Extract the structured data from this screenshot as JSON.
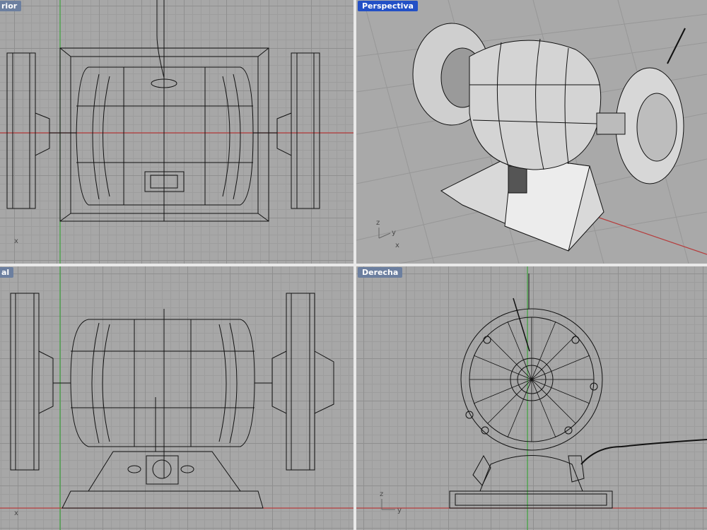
{
  "viewports": {
    "top": {
      "title": "rior",
      "axis_x": "x",
      "active": false
    },
    "perspective": {
      "title": "Perspectiva",
      "axis_x": "x",
      "axis_y": "y",
      "axis_z": "z",
      "active": true
    },
    "front": {
      "title": "al",
      "axis_x": "x",
      "active": false
    },
    "right": {
      "title": "Derecha",
      "axis_y": "y",
      "axis_z": "z",
      "active": false
    }
  },
  "colors": {
    "viewport_bg": "#a7a7a7",
    "grid_major": "#8f8f8f",
    "grid_minor": "#9d9d9d",
    "axis_x_red": "#b63c3c",
    "axis_y_green": "#3da33d",
    "wireframe": "#111111",
    "title_active": "#2350c6"
  },
  "model": {
    "icon": "bench-grinder-wireframe-icon"
  }
}
